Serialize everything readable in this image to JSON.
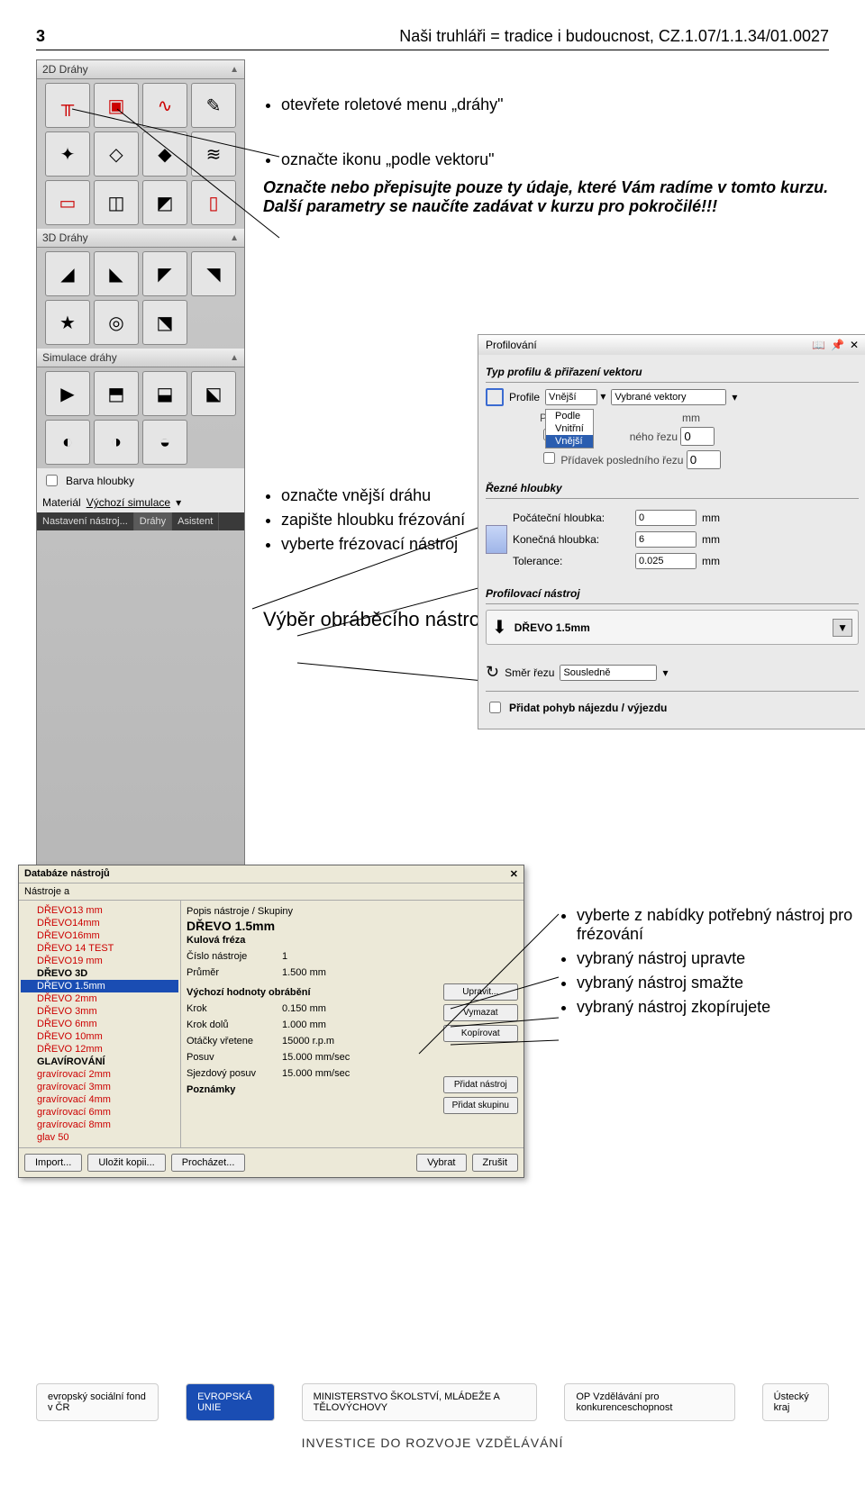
{
  "header": {
    "page_num": "3",
    "project": "Naši truhláři = tradice i budoucnost, CZ.1.07/1.1.34/01.0027"
  },
  "sections": {
    "s2d": "2D Dráhy",
    "s3d": "3D Dráhy",
    "sim": "Simulace dráhy",
    "barva": "Barva hloubky",
    "material": "Materiál",
    "material_value": "Výchozí simulace",
    "tabs": [
      "Nastavení nástroj...",
      "Dráhy",
      "Asistent"
    ]
  },
  "text": {
    "b1": "otevřete roletové menu „dráhy\"",
    "b2": "označte ikonu „podle vektoru\"",
    "bold": "Označte nebo přepisujte pouze ty údaje, které Vám radíme v tomto kurzu. Další parametry se naučíte zadávat v kurzu pro pokročilé!!!",
    "b3": "označte vnější dráhu",
    "b4": "zapište hloubku frézování",
    "b5": "vyberte frézovací nástroj",
    "vyber": "Výběr obráběcího nástroje",
    "rb1": "vyberte z nabídky potřebný nástroj pro frézování",
    "rb2": "vybraný nástroj upravte",
    "rb3": "vybraný nástroj smažte",
    "rb4": "vybraný nástroj zkopírujete"
  },
  "profil": {
    "title": "Profilování",
    "section1": "Typ profilu & přiřazení vektoru",
    "profile_lbl": "Profile",
    "profile_val": "Vnější",
    "vectors_val": "Vybrané vektory",
    "pridavek_lbl": "Přídave",
    "pridavek_unit": "mm",
    "pri_first": "Při",
    "pri_first_tail": "ného řezu",
    "pri_first_val": "0",
    "pridavek_posl": "Přídavek posledního řezu",
    "pridavek_posl_val": "0",
    "dropdown": [
      "Podle",
      "Vnitřní",
      "Vnější"
    ],
    "section2": "Řezné hloubky",
    "poc_h": "Počáteční hloubka:",
    "poc_v": "0",
    "kon_h": "Konečná hloubka:",
    "kon_v": "6",
    "tol": "Tolerance:",
    "tol_v": "0.025",
    "mm": "mm",
    "section3": "Profilovací nástroj",
    "tool_name": "DŘEVO 1.5mm",
    "smer": "Směr řezu",
    "smer_v": "Sousledně",
    "pridat_najezd": "Přidat pohyb nájezdu / výjezdu"
  },
  "db": {
    "title": "Databáze nástrojů",
    "nastroje_a": "Nástroje a",
    "tree": [
      "DŘEVO13 mm",
      "DŘEVO14mm",
      "DŘEVO16mm",
      "DŘEVO 14    TEST",
      "DŘEVO19 mm",
      "DŘEVO 3D",
      "DŘEVO 1.5mm",
      "DŘEVO 2mm",
      "DŘEVO 3mm",
      "DŘEVO 6mm",
      "DŘEVO 10mm",
      "DŘEVO 12mm",
      "GLAVÍROVÁNÍ",
      "gravírovací 2mm",
      "gravírovací 3mm",
      "gravírovací 4mm",
      "gravírovací 6mm",
      "gravírovací 8mm",
      "glav 50"
    ],
    "desc_title": "Popis nástroje / Skupiny",
    "drevo15": "DŘEVO 1.5mm",
    "kind": "Kulová fréza",
    "fields": [
      [
        "Číslo nástroje",
        "1"
      ],
      [
        "Průměr",
        "1.500 mm"
      ]
    ],
    "valhead": "Výchozí hodnoty obrábění",
    "vals": [
      [
        "Krok",
        "0.150 mm"
      ],
      [
        "Krok dolů",
        "1.000 mm"
      ],
      [
        "Otáčky vřetene",
        "15000 r.p.m"
      ],
      [
        "Posuv",
        "15.000 mm/sec"
      ],
      [
        "Sjezdový posuv",
        "15.000 mm/sec"
      ]
    ],
    "poznamky": "Poznámky",
    "btns": [
      "Upravit...",
      "Vymazat",
      "Kopírovat"
    ],
    "btns2": [
      "Přidat nástroj",
      "Přidat skupinu"
    ],
    "bottom": [
      "Import...",
      "Uložit kopii...",
      "Procházet...",
      "Vybrat",
      "Zrušit"
    ]
  },
  "footer": {
    "invest": "INVESTICE DO ROZVOJE VZDĚLÁVÁNÍ",
    "logos": [
      "evropský sociální fond v ČR",
      "EVROPSKÁ UNIE",
      "MINISTERSTVO ŠKOLSTVÍ, MLÁDEŽE A TĚLOVÝCHOVY",
      "OP Vzdělávání pro konkurenceschopnost",
      "Ústecký kraj"
    ]
  }
}
